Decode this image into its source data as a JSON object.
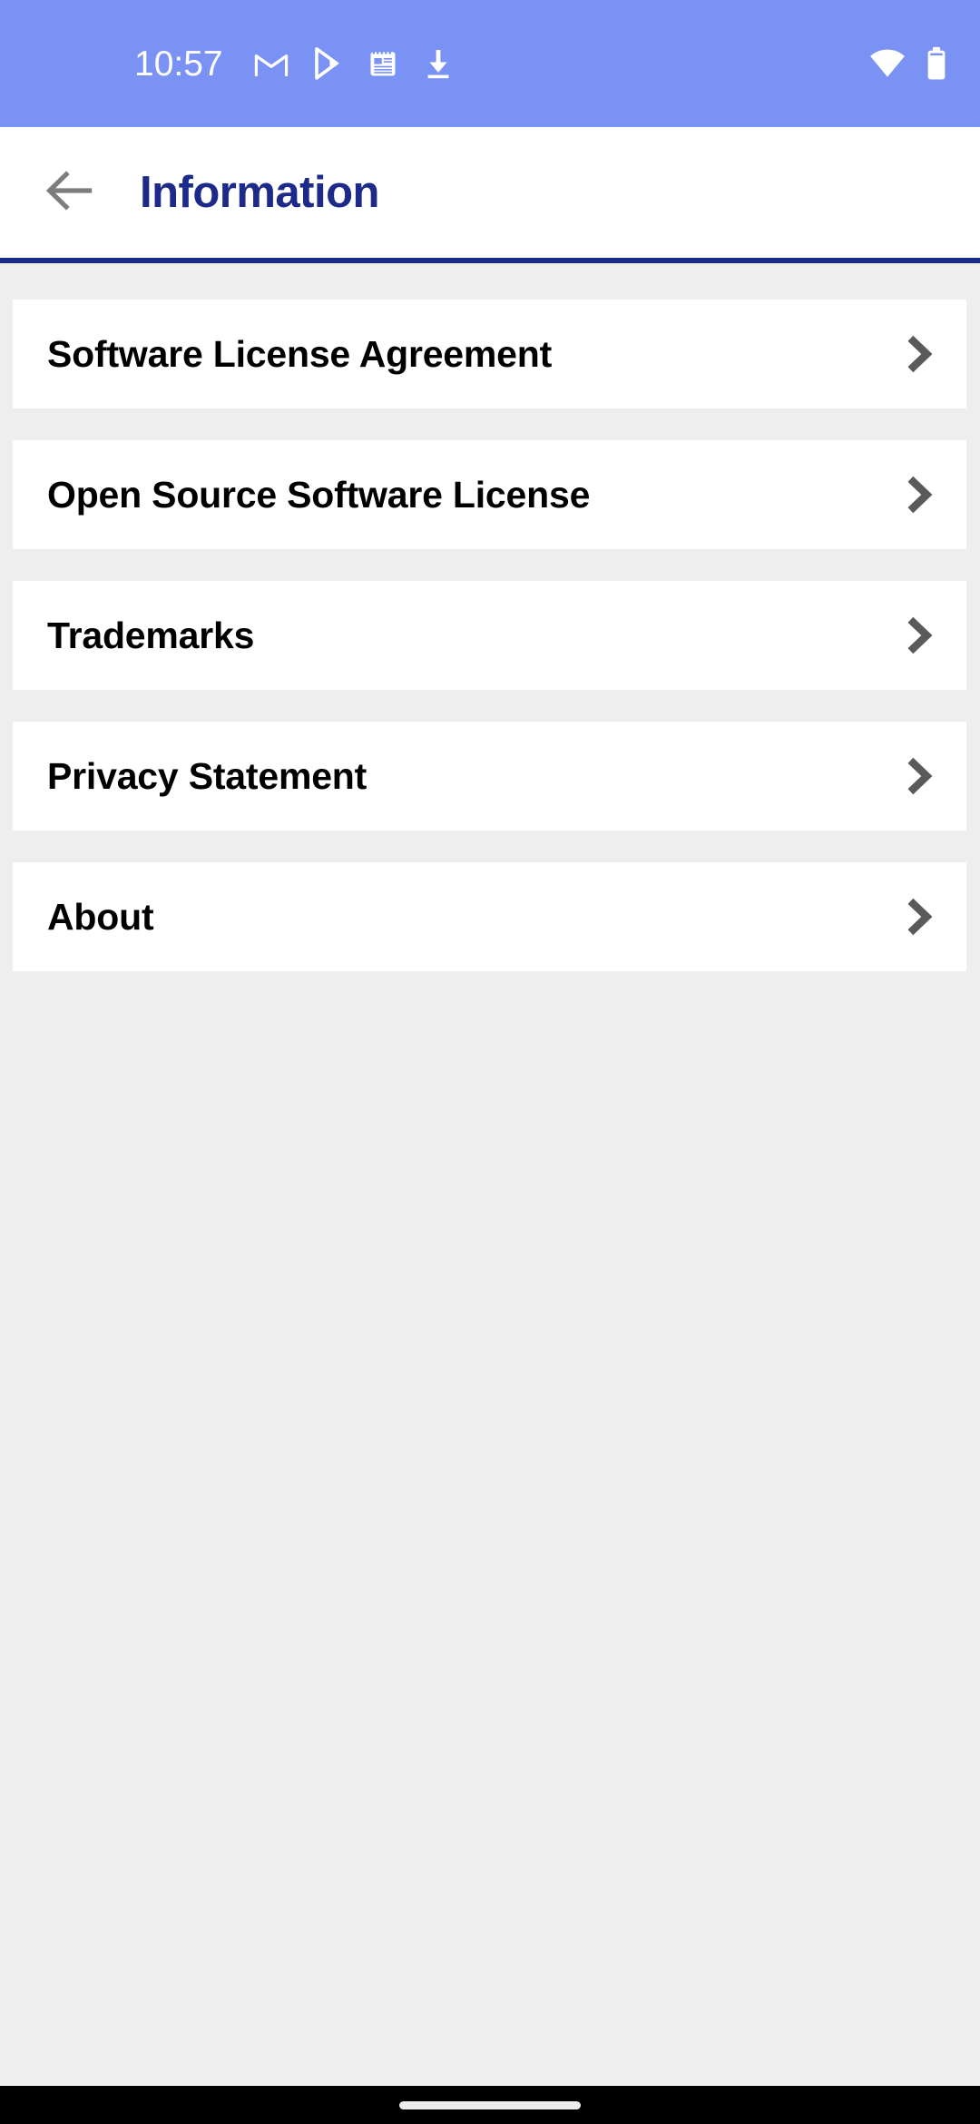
{
  "status_bar": {
    "time": "10:57",
    "background_color": "#7b92f5",
    "icons": [
      "gmail-icon",
      "play-store-icon",
      "notes-icon",
      "download-icon"
    ],
    "right_icons": [
      "wifi-icon",
      "battery-icon"
    ]
  },
  "app_bar": {
    "back_icon": "back-arrow-icon",
    "title": "Information",
    "title_color": "#1d2a8a",
    "underline_color": "#182987"
  },
  "list": {
    "items": [
      {
        "label": "Software License Agreement",
        "chevron": "chevron-right-icon"
      },
      {
        "label": "Open Source Software License",
        "chevron": "chevron-right-icon"
      },
      {
        "label": "Trademarks",
        "chevron": "chevron-right-icon"
      },
      {
        "label": "Privacy Statement",
        "chevron": "chevron-right-icon"
      },
      {
        "label": "About",
        "chevron": "chevron-right-icon"
      }
    ]
  },
  "nav_bar": {
    "gesture_pill": "home-gesture-pill",
    "background_color": "#000000"
  },
  "theme": {
    "page_background": "#eeeeee",
    "card_background": "#ffffff",
    "chevron_color": "#5a5a5a",
    "label_color": "#000000"
  }
}
